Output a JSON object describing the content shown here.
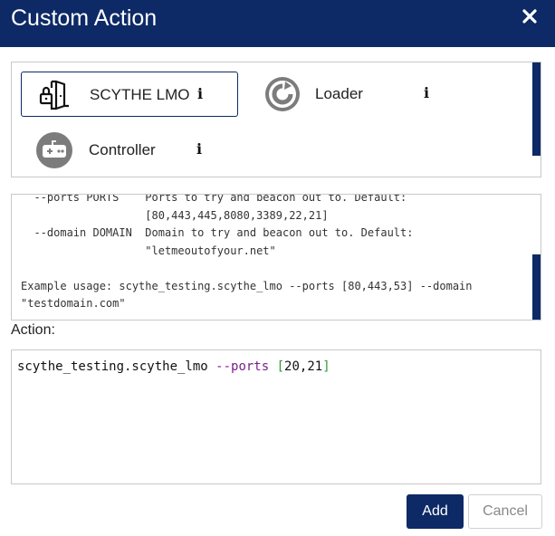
{
  "dialog": {
    "title": "Custom Action",
    "close_icon": "close-icon"
  },
  "plugins": [
    {
      "label": "SCYTHE LMO",
      "icon": "door-lock-icon",
      "selected": true,
      "info": "i"
    },
    {
      "label": "Loader",
      "icon": "loader-circle-icon",
      "selected": false,
      "info": "i"
    },
    {
      "label": "Controller",
      "icon": "controller-icon",
      "selected": false,
      "info": "i"
    }
  ],
  "help": {
    "lines": [
      "  --ports PORTS    Ports to try and beacon out to. Default:",
      "                   [80,443,445,8080,3389,22,21]",
      "  --domain DOMAIN  Domain to try and beacon out to. Default:",
      "                   \"letmeoutofyour.net\"",
      "",
      "Example usage: scythe_testing.scythe_lmo --ports [80,443,53] --domain",
      "\"testdomain.com\""
    ]
  },
  "action": {
    "label": "Action:",
    "command": "scythe_testing.scythe_lmo",
    "flag": "--ports",
    "bracket_open": "[",
    "value": "20,21",
    "bracket_close": "]"
  },
  "buttons": {
    "add": "Add",
    "cancel": "Cancel"
  },
  "colors": {
    "brand": "#0d2a66",
    "flag": "#7a1f8c",
    "bracket": "#2e9b2e"
  }
}
